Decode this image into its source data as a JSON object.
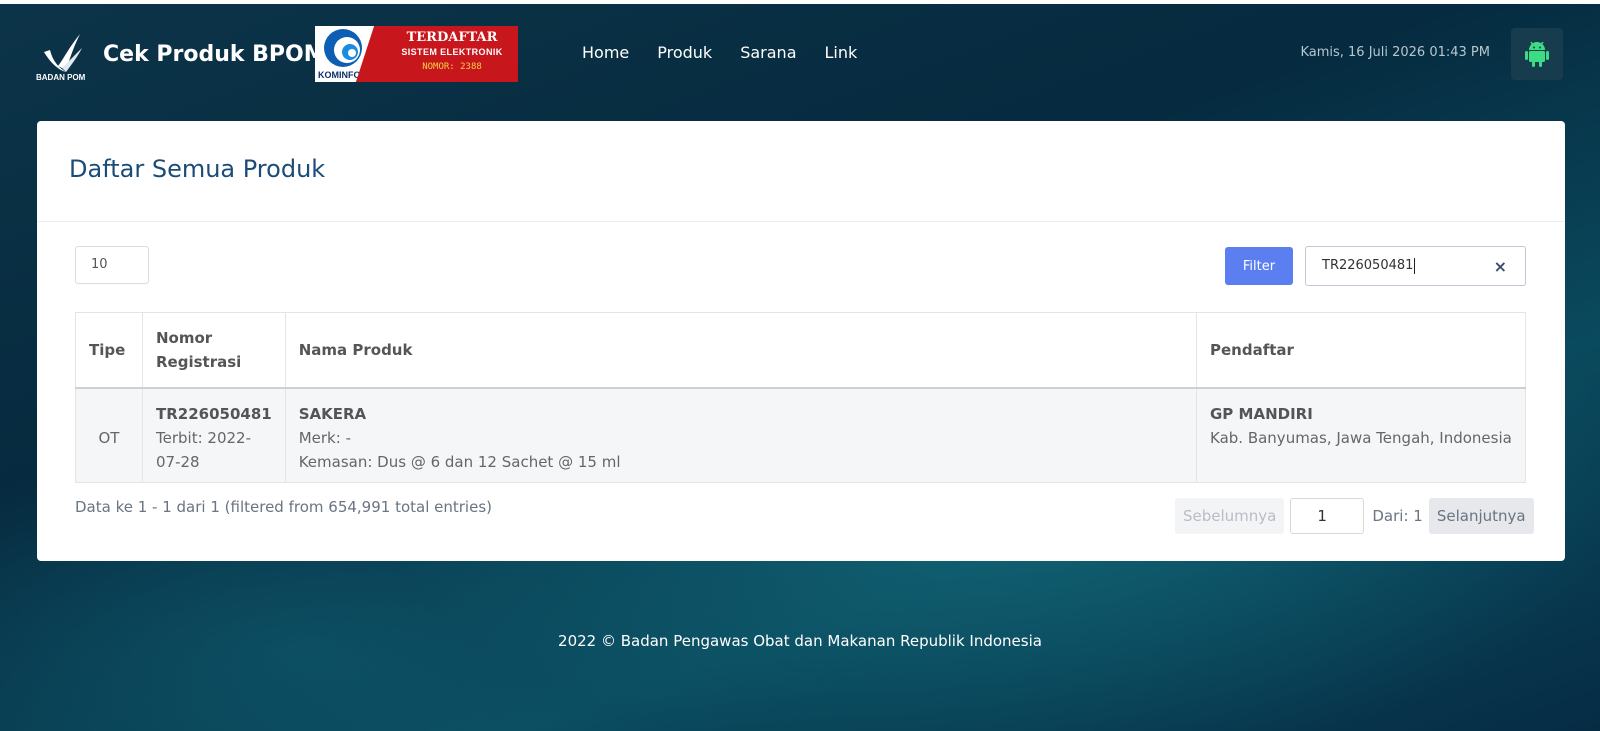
{
  "header": {
    "logo_caption": "BADAN POM",
    "brand": "Cek Produk BPOM",
    "kominfo_badge": {
      "left_label": "KOMINFO",
      "line1": "TERDAFTAR",
      "line2": "SISTEM ELEKTRONIK",
      "line3": "NOMOR: 2388"
    },
    "nav": [
      "Home",
      "Produk",
      "Sarana",
      "Link"
    ],
    "datetime": "Kamis, 16 Juli 2026 01:43 PM",
    "android_icon": "android-icon"
  },
  "card": {
    "title": "Daftar Semua Produk",
    "page_length": "10",
    "filter_label": "Filter",
    "search_value": "TR226050481",
    "clear_icon": "×"
  },
  "table": {
    "headers": [
      "Tipe",
      "Nomor Registrasi",
      "Nama Produk",
      "Pendaftar"
    ],
    "rows": [
      {
        "tipe": "OT",
        "nomor": "TR226050481",
        "terbit": "Terbit: 2022-07-28",
        "nama": "SAKERA",
        "merk": "Merk: -",
        "kemasan": "Kemasan: Dus @ 6 dan 12 Sachet @ 15 ml",
        "pendaftar": "GP MANDIRI",
        "alamat": "Kab. Banyumas, Jawa Tengah, Indonesia"
      }
    ]
  },
  "info": "Data ke 1 - 1 dari 1 (filtered from 654,991 total entries)",
  "pager": {
    "prev": "Sebelumnya",
    "current": "1",
    "of": "Dari: 1",
    "next": "Selanjutnya"
  },
  "footer": "2022 ©  Badan Pengawas Obat dan Makanan Republik Indonesia",
  "colors": {
    "title": "#1b4c78",
    "filter_button": "#5b7ff0",
    "android": "#3ddc84"
  }
}
